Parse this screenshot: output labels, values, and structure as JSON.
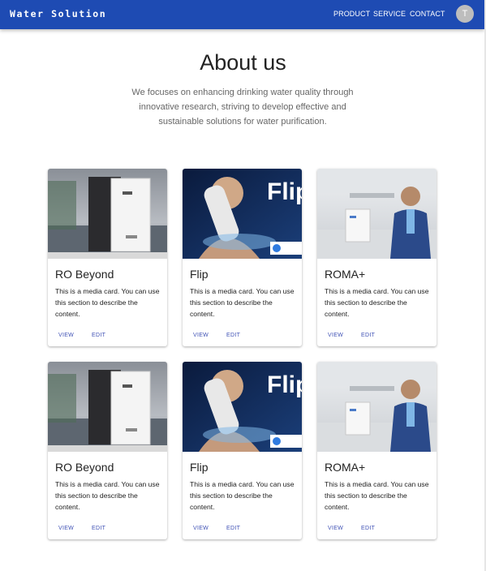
{
  "header": {
    "brand": "Water Solution",
    "nav": [
      "PRODUCT",
      "SERVICE",
      "CONTACT"
    ],
    "avatar": "T",
    "accent_color": "#1e4bb3"
  },
  "hero": {
    "title": "About us",
    "subtitle": "We focuses on enhancing drinking water quality through innovative research, striving to develop effective and sustainable solutions for water purification."
  },
  "cards": [
    {
      "title": "RO Beyond",
      "text": "This is a media card. You can use this section to describe the content.",
      "view": "VIEW",
      "edit": "EDIT"
    },
    {
      "title": "Flip",
      "text": "This is a media card. You can use this section to describe the content.",
      "view": "VIEW",
      "edit": "EDIT",
      "image_text": "Flip"
    },
    {
      "title": "ROMA+",
      "text": "This is a media card. You can use this section to describe the content.",
      "view": "VIEW",
      "edit": "EDIT"
    },
    {
      "title": "RO Beyond",
      "text": "This is a media card. You can use this section to describe the content.",
      "view": "VIEW",
      "edit": "EDIT"
    },
    {
      "title": "Flip",
      "text": "This is a media card. You can use this section to describe the content.",
      "view": "VIEW",
      "edit": "EDIT",
      "image_text": "Flip"
    },
    {
      "title": "ROMA+",
      "text": "This is a media card. You can use this section to describe the content.",
      "view": "VIEW",
      "edit": "EDIT"
    }
  ]
}
